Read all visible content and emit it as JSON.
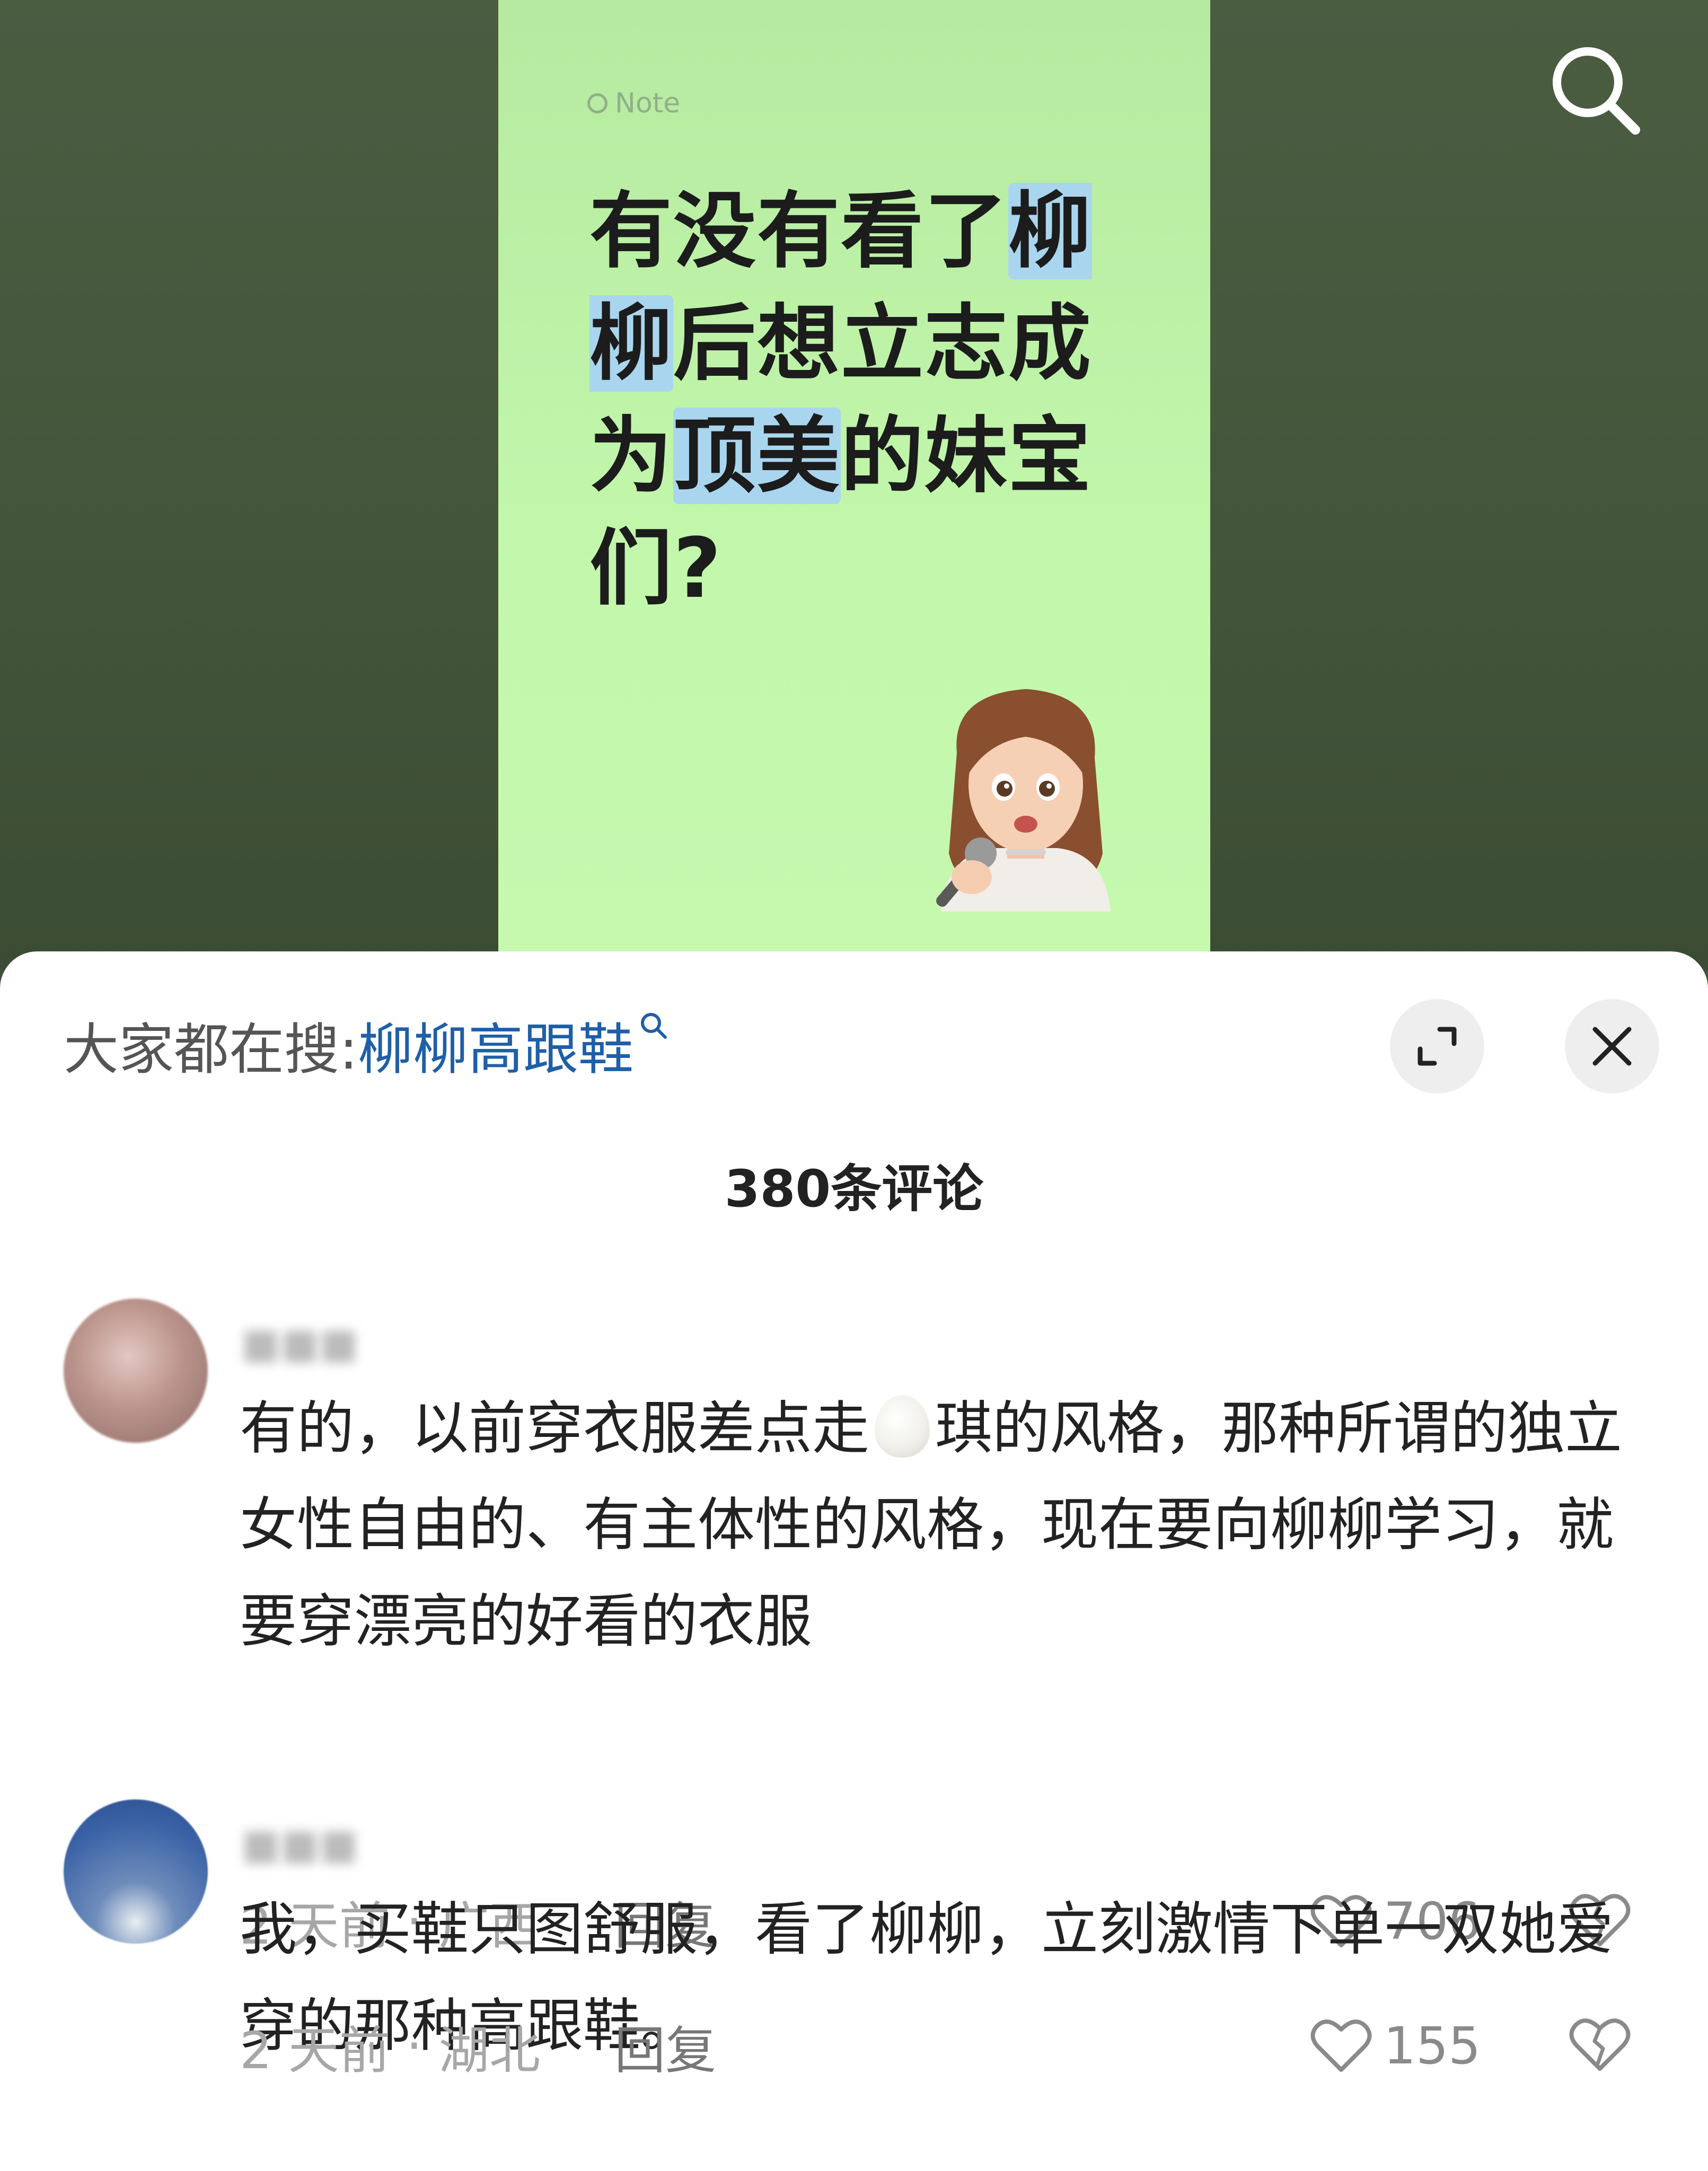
{
  "note": {
    "tag": "Note",
    "title_parts": [
      "有没有看了",
      "柳柳",
      "后想立志成为",
      "顶美",
      "的妹宝们?"
    ]
  },
  "header": {
    "trending_label": "大家都在搜:",
    "trending_keyword": "柳柳高跟鞋"
  },
  "comments_header": {
    "count_text": "380条评论"
  },
  "comments": [
    {
      "text_before_emoji": "有的，以前穿衣服差点走",
      "emoji": "egg",
      "text_after_emoji": "琪的风格，那种所谓的独立女性自由的、有主体性的风格，现在要向柳柳学习，就要穿漂亮的好看的衣服",
      "time": "2 天前",
      "location": "广西",
      "reply_label": "回复",
      "likes": "706"
    },
    {
      "text": "我，买鞋只图舒服，看了柳柳，立刻激情下单一双她爱穿的那种高跟鞋。",
      "time": "2 天前",
      "location": "湖北",
      "reply_label": "回复",
      "likes": "155"
    }
  ],
  "colors": {
    "note_bg": "#c2f7ac",
    "highlight": "#a9d6ee",
    "keyword": "#1f5fa8",
    "background": "#43563b"
  }
}
